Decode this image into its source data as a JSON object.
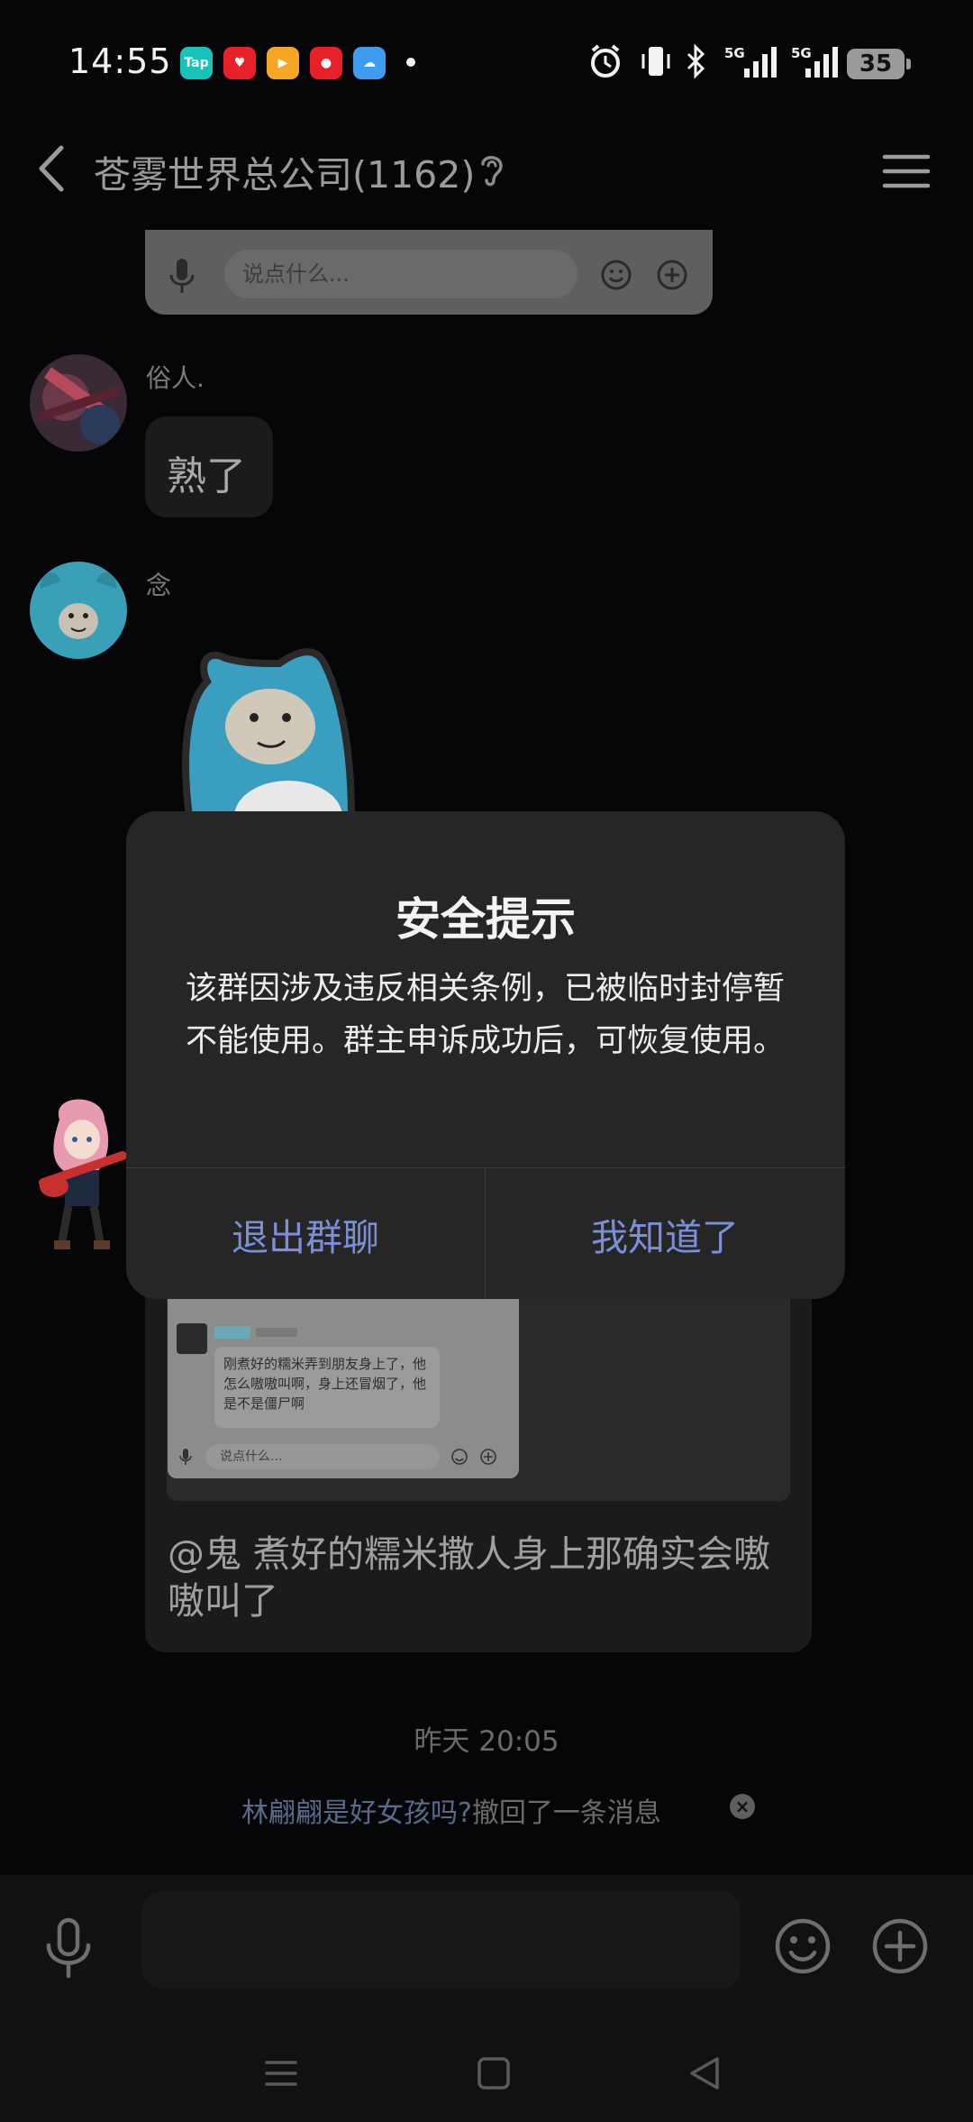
{
  "status_bar": {
    "time": "14:55",
    "apps": [
      {
        "name": "taptap-icon",
        "label": "Tap",
        "color": "#16c3b8"
      },
      {
        "name": "heart-app-icon",
        "label": "",
        "color": "#e8202a"
      },
      {
        "name": "video-app-icon",
        "label": "",
        "color": "#f5a623"
      },
      {
        "name": "mascot-app-icon",
        "label": "",
        "color": "#e8202a"
      },
      {
        "name": "weather-app-icon",
        "label": "",
        "color": "#3d9bf0"
      }
    ],
    "network_1": "5G",
    "network_2": "5G",
    "battery": "35"
  },
  "header": {
    "title": "苍雾世界总公司(1162)"
  },
  "chat": {
    "screenshot_top": {
      "placeholder": "说点什么..."
    },
    "messages": [
      {
        "sender": "俗人.",
        "text": "熟了"
      },
      {
        "sender": "念"
      }
    ],
    "quote_card": {
      "shot_placeholder": "说点什么...",
      "shot_message": "刚煮好的糯米弄到朋友身上了，他怎么嗷嗷叫啊，身上还冒烟了，他是不是僵尸啊",
      "text": "@鬼 煮好的糯米撒人身上那确实会嗷嗷叫了"
    },
    "time_label": "昨天 20:05",
    "recall": {
      "who": "林翩翩是好女孩吗?",
      "action": "撤回了一条消息"
    }
  },
  "dialog": {
    "title": "安全提示",
    "message": "该群因涉及违反相关条例，已被临时封停暂不能使用。群主申诉成功后，可恢复使用。",
    "exit_label": "退出群聊",
    "ok_label": "我知道了"
  },
  "colors": {
    "accent": "#7a8fd8",
    "dialog_bg": "#262626",
    "page_bg": "#060608"
  }
}
